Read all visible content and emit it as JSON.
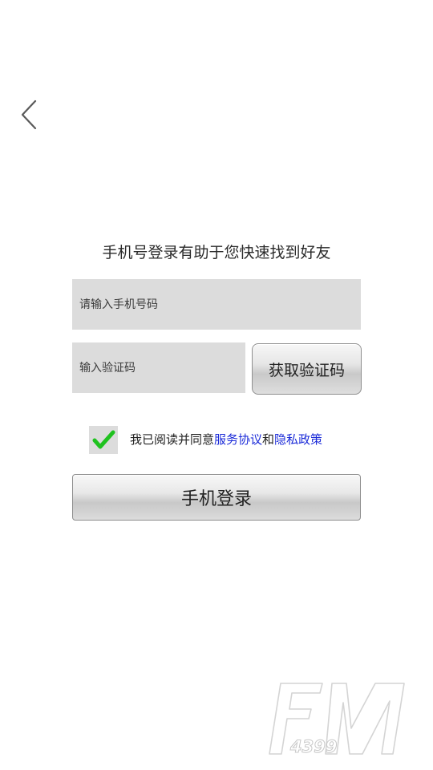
{
  "subtitle": "手机号登录有助于您快速找到好友",
  "phone_input": {
    "placeholder": "请输入手机号码",
    "value": ""
  },
  "code_input": {
    "placeholder": "输入验证码",
    "value": ""
  },
  "get_code_button": {
    "label": "获取验证码"
  },
  "agreement": {
    "checked": true,
    "prefix": "我已阅读并同意",
    "service_link": "服务协议",
    "conjunction": "和",
    "privacy_link": "隐私政策"
  },
  "login_button": {
    "label": "手机登录"
  },
  "watermark": {
    "brand": "FM",
    "number": "4399"
  },
  "colors": {
    "link": "#1a2ad8",
    "check": "#1fc21f",
    "input_bg": "#dcdcdc"
  },
  "icons": {
    "back": "chevron-left-icon",
    "check": "checkmark-icon"
  }
}
